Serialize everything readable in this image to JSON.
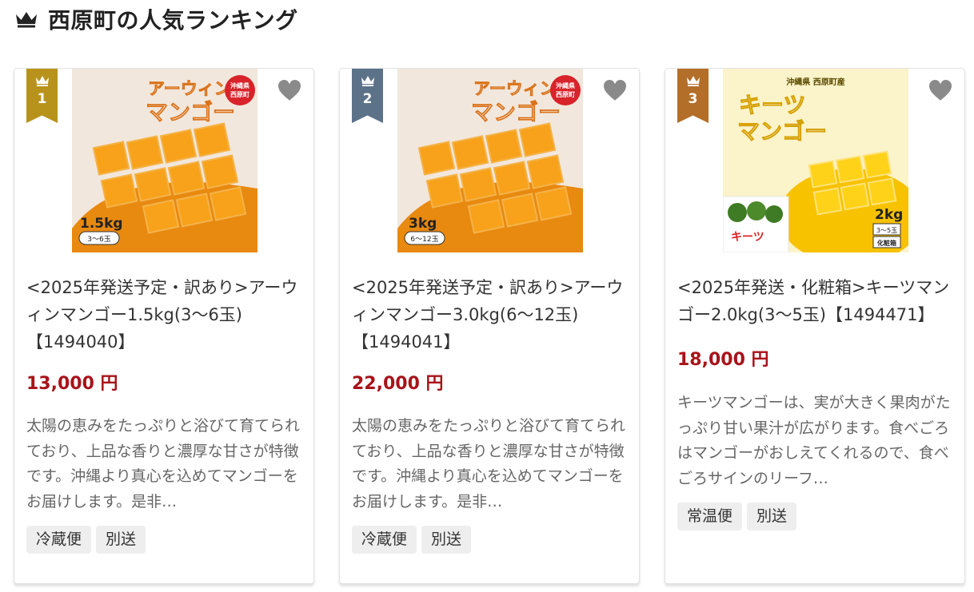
{
  "page": {
    "heading": "西原町の人気ランキング",
    "heading_icon": "crown-icon"
  },
  "colors": {
    "rank1": "#b8931c",
    "rank2": "#5c7289",
    "rank3": "#b36e2a",
    "price": "#a8131a",
    "heart": "#8a8a8a"
  },
  "products": [
    {
      "rank": "1",
      "image": {
        "brand_line1": "アーウィン",
        "brand_line2": "マンゴー",
        "badge_line1": "沖縄県",
        "badge_line2": "西原町",
        "weight": "1.5kg",
        "count": "3〜6玉"
      },
      "title": "<2025年発送予定・訳あり>アーウィンマンゴー1.5kg(3〜6玉)【1494040】",
      "price": "13,000 円",
      "description": "太陽の恵みをたっぷりと浴びて育てられており、上品な香りと濃厚な甘さが特徴です。沖縄より真心を込めてマンゴーをお届けします。是非…",
      "tags": [
        "冷蔵便",
        "別送"
      ]
    },
    {
      "rank": "2",
      "image": {
        "brand_line1": "アーウィン",
        "brand_line2": "マンゴー",
        "badge_line1": "沖縄県",
        "badge_line2": "西原町",
        "weight": "3kg",
        "count": "6〜12玉"
      },
      "title": "<2025年発送予定・訳あり>アーウィンマンゴー3.0kg(6〜12玉)【1494041】",
      "price": "22,000 円",
      "description": "太陽の恵みをたっぷりと浴びて育てられており、上品な香りと濃厚な甘さが特徴です。沖縄より真心を込めてマンゴーをお届けします。是非…",
      "tags": [
        "冷蔵便",
        "別送"
      ]
    },
    {
      "rank": "3",
      "image": {
        "origin": "沖縄県 西原町産",
        "brand_line1": "キーツ",
        "brand_line2": "マンゴー",
        "weight": "2kg",
        "count": "3〜5玉",
        "box": "化粧箱"
      },
      "title": "<2025年発送・化粧箱>キーツマンゴー2.0kg(3〜5玉)【1494471】",
      "price": "18,000 円",
      "description": "キーツマンゴーは、実が大きく果肉がたっぷり甘い果汁が広がります。食べごろはマンゴーがおしえてくれるので、食べごろサインのリーフ…",
      "tags": [
        "常温便",
        "別送"
      ]
    }
  ]
}
